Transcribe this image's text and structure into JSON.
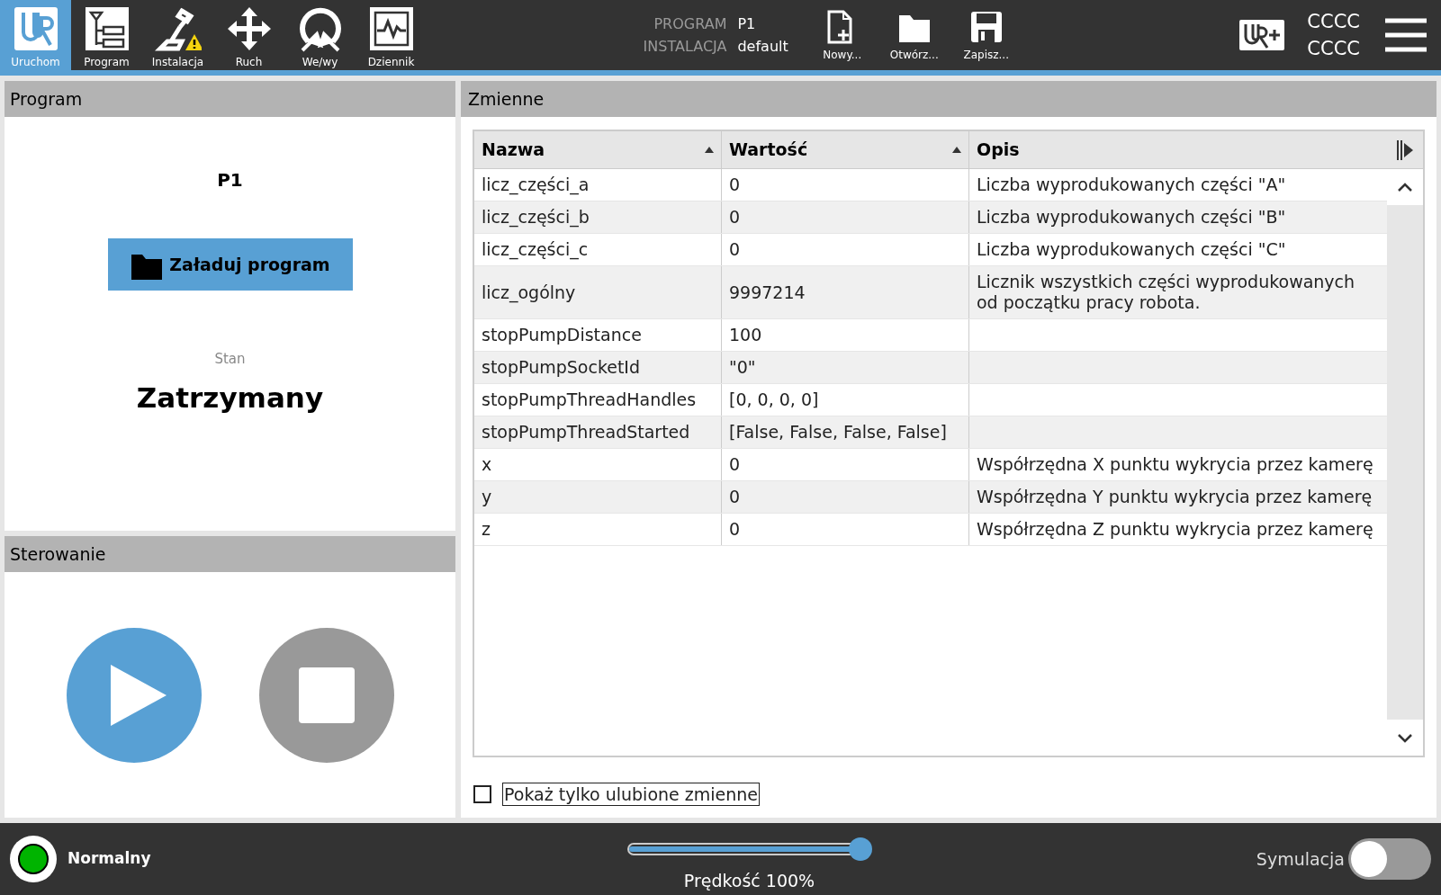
{
  "top_nav": {
    "tabs": [
      {
        "label": "Uruchom",
        "kind": "logo",
        "selected": true
      },
      {
        "label": "Program",
        "kind": "tree",
        "selected": false
      },
      {
        "label": "Instalacja",
        "kind": "robot",
        "selected": false
      },
      {
        "label": "Ruch",
        "kind": "move",
        "selected": false
      },
      {
        "label": "We/wy",
        "kind": "io",
        "selected": false
      },
      {
        "label": "Dziennik",
        "kind": "log",
        "selected": false
      }
    ],
    "program_info": {
      "program_label": "PROGRAM",
      "program": "P1",
      "installation_label": "INSTALACJA",
      "installation": "default"
    },
    "file_actions": [
      {
        "label": "Nowy...",
        "kind": "new"
      },
      {
        "label": "Otwórz...",
        "kind": "open"
      },
      {
        "label": "Zapisz...",
        "kind": "save"
      }
    ],
    "header_right": {
      "line_1": "CCCC",
      "line_2": "CCCC"
    }
  },
  "program_panel": {
    "title": "Program",
    "program_name": "P1",
    "load_button": "Załaduj program",
    "state_label": "Stan",
    "state": "Zatrzymany"
  },
  "control_panel": {
    "title": "Sterowanie",
    "play_disabled": false,
    "stop_disabled": true
  },
  "variables_panel": {
    "title": "Zmienne",
    "columns": [
      {
        "label": "Nazwa",
        "sorted": true
      },
      {
        "label": "Wartość",
        "sorted": true
      },
      {
        "label": "Opis",
        "sorted": false
      }
    ],
    "rows": [
      {
        "name": "licz_części_a",
        "value": "0",
        "description": "Liczba wyprodukowanych części \"A\""
      },
      {
        "name": "licz_części_b",
        "value": "0",
        "description": "Liczba wyprodukowanych części \"B\""
      },
      {
        "name": "licz_części_c",
        "value": "0",
        "description": "Liczba wyprodukowanych części \"C\""
      },
      {
        "name": "licz_ogólny",
        "value": "9997214",
        "description": "Licznik wszystkich części wyprodukowanych od początku pracy robota."
      },
      {
        "name": "stopPumpDistance",
        "value": "100",
        "description": ""
      },
      {
        "name": "stopPumpSocketId",
        "value": "\"0\"",
        "description": ""
      },
      {
        "name": "stopPumpThreadHandles",
        "value": "[0, 0, 0, 0]",
        "description": ""
      },
      {
        "name": "stopPumpThreadStarted",
        "value": "[False, False, False, False]",
        "description": ""
      },
      {
        "name": "x",
        "value": "0",
        "description": "Współrzędna X punktu wykrycia przez kamerę"
      },
      {
        "name": "y",
        "value": "0",
        "description": "Współrzędna Y punktu wykrycia przez kamerę"
      },
      {
        "name": "z",
        "value": "0",
        "description": "Współrzędna Z punktu wykrycia przez kamerę"
      }
    ],
    "favorites_only": {
      "label": "Pokaż tylko ulubione zmienne",
      "checked": false
    }
  },
  "status_bar": {
    "status": "Normalny",
    "speed": {
      "level": 1.0,
      "reading": "Prędkość 100%"
    },
    "simulation": {
      "label": "Symulacja",
      "on": false
    }
  }
}
